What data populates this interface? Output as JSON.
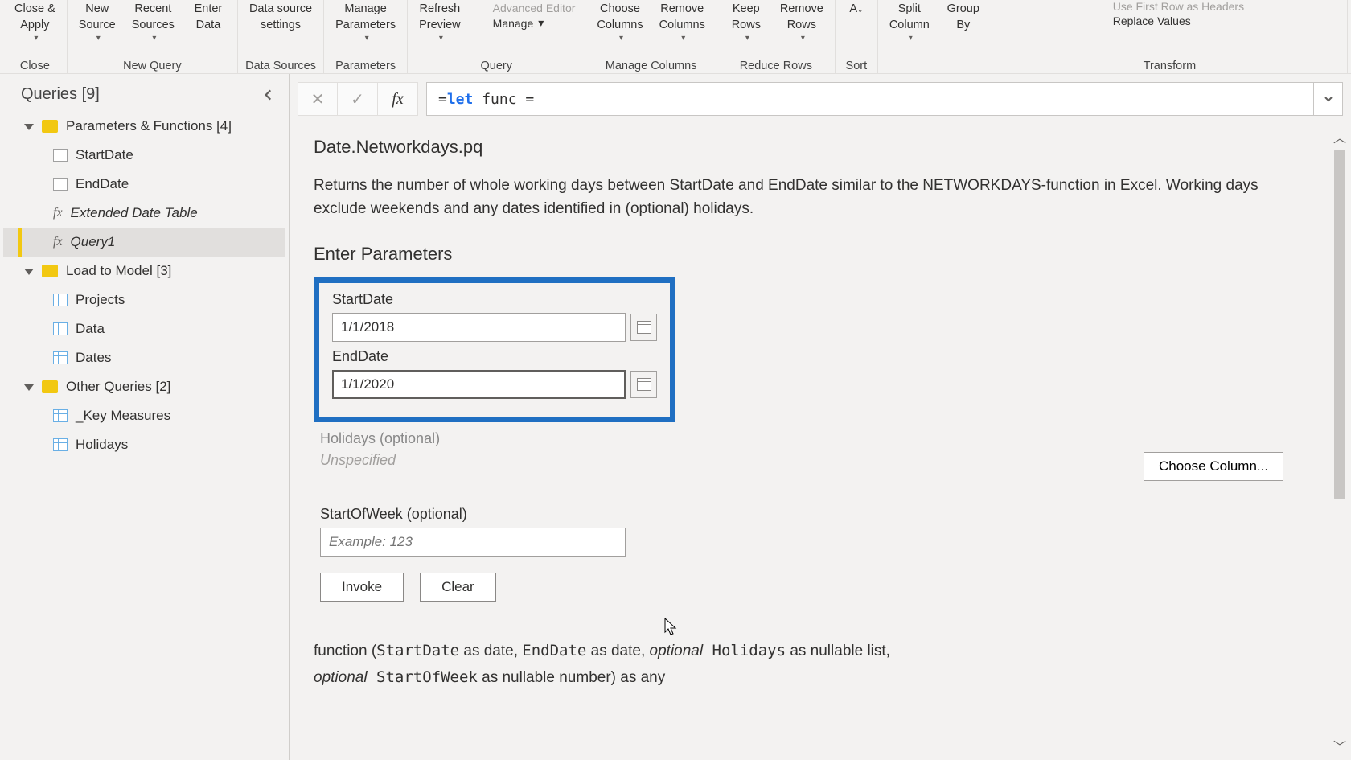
{
  "ribbon": {
    "groups": [
      {
        "label": "Close",
        "buttons": [
          {
            "text": "Close &\nApply",
            "dd": true
          }
        ]
      },
      {
        "label": "New Query",
        "buttons": [
          {
            "text": "New\nSource",
            "dd": true
          },
          {
            "text": "Recent\nSources",
            "dd": true
          },
          {
            "text": "Enter\nData",
            "dd": false
          }
        ]
      },
      {
        "label": "Data Sources",
        "buttons": [
          {
            "text": "Data source\nsettings",
            "dd": false
          }
        ]
      },
      {
        "label": "Parameters",
        "buttons": [
          {
            "text": "Manage\nParameters",
            "dd": true
          }
        ]
      },
      {
        "label": "Query",
        "buttons": [
          {
            "text": "Refresh\nPreview",
            "dd": true
          }
        ],
        "side": [
          {
            "text": "Advanced Editor",
            "dim": true
          },
          {
            "text": "Manage",
            "dd": true
          }
        ]
      },
      {
        "label": "Manage Columns",
        "buttons": [
          {
            "text": "Choose\nColumns",
            "dd": true
          },
          {
            "text": "Remove\nColumns",
            "dd": true
          }
        ]
      },
      {
        "label": "Reduce Rows",
        "buttons": [
          {
            "text": "Keep\nRows",
            "dd": true
          },
          {
            "text": "Remove\nRows",
            "dd": true
          }
        ]
      },
      {
        "label": "Sort",
        "buttons": [
          {
            "text": "",
            "icon": true
          }
        ]
      },
      {
        "label": "",
        "buttons": [
          {
            "text": "Split\nColumn",
            "dd": true
          },
          {
            "text": "Group\nBy",
            "dd": false
          }
        ]
      },
      {
        "label": "Transform",
        "side": [
          {
            "text": "Use First Row as Headers",
            "dim": true
          },
          {
            "text": "Replace Values"
          }
        ]
      }
    ]
  },
  "queries": {
    "header": "Queries [9]",
    "groups": [
      {
        "name": "Parameters & Functions [4]",
        "items": [
          {
            "type": "param",
            "label": "StartDate"
          },
          {
            "type": "param",
            "label": "EndDate"
          },
          {
            "type": "fx",
            "label": "Extended Date Table"
          },
          {
            "type": "fx",
            "label": "Query1",
            "selected": true
          }
        ]
      },
      {
        "name": "Load to Model [3]",
        "items": [
          {
            "type": "table",
            "label": "Projects"
          },
          {
            "type": "table",
            "label": "Data"
          },
          {
            "type": "table",
            "label": "Dates"
          }
        ]
      },
      {
        "name": "Other Queries [2]",
        "items": [
          {
            "type": "table",
            "label": "_Key Measures"
          },
          {
            "type": "table",
            "label": "Holidays"
          }
        ]
      }
    ]
  },
  "formula": {
    "prefix": "= ",
    "kw1": "let",
    "mid": "func",
    "eq": "="
  },
  "function": {
    "title": "Date.Networkdays.pq",
    "description": "Returns the number of whole working days between StartDate and EndDate similar to the NETWORKDAYS-function in Excel. Working days exclude weekends and any dates identified in (optional) holidays.",
    "enter_params": "Enter Parameters",
    "params": {
      "start_label": "StartDate",
      "start_value": "1/1/2018",
      "end_label": "EndDate",
      "end_value": "1/1/2020",
      "holidays_label": "Holidays (optional)",
      "holidays_value": "Unspecified",
      "choose_column": "Choose Column...",
      "sow_label": "StartOfWeek (optional)",
      "sow_placeholder": "Example: 123"
    },
    "actions": {
      "invoke": "Invoke",
      "clear": "Clear"
    },
    "signature": {
      "p1a": "function (",
      "p1b": "StartDate",
      "p1c": " as date, ",
      "p1d": "EndDate",
      "p1e": " as date, ",
      "p1f": "optional",
      "p1g": " Holidays",
      "p1h": " as nullable list,",
      "p2a": "optional",
      "p2b": " StartOfWeek",
      "p2c": " as nullable number) as any"
    }
  }
}
